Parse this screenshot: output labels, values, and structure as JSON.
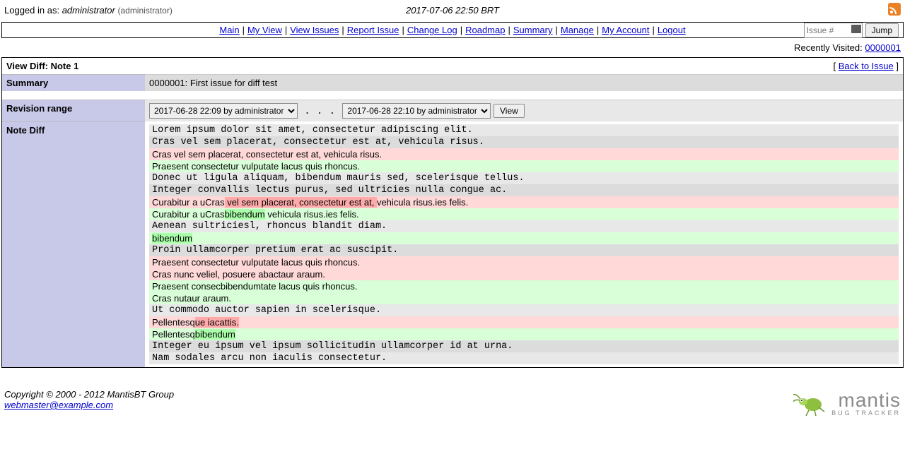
{
  "top": {
    "logged_in_prefix": "Logged in as:",
    "username": "administrator",
    "role": "(administrator)",
    "datetime": "2017-07-06 22:50 BRT"
  },
  "nav": {
    "links": [
      "Main",
      "My View",
      "View Issues",
      "Report Issue",
      "Change Log",
      "Roadmap",
      "Summary",
      "Manage",
      "My Account",
      "Logout"
    ],
    "issue_placeholder": "Issue #",
    "jump_label": "Jump"
  },
  "recently": {
    "label": "Recently Visited:",
    "link": "0000001"
  },
  "panel": {
    "title": "View Diff: Note 1",
    "back_prefix": "[ ",
    "back_link": "Back to Issue",
    "back_suffix": " ]",
    "summary_label": "Summary",
    "summary_value": "0000001: First issue for diff test",
    "revision_label": "Revision range",
    "rev_from": "2017-06-28 22:09 by administrator",
    "rev_to": "2017-06-28 22:10 by administrator",
    "dots": ". . .",
    "view_label": "View",
    "diff_label": "Note Diff"
  },
  "diff": {
    "lines": [
      {
        "class": "mono ctx-a",
        "text": "Lorem ipsum dolor sit amet, consectetur adipiscing elit."
      },
      {
        "class": "mono ctx-b",
        "text": "Cras vel sem placerat, consectetur est at, vehicula risus."
      },
      {
        "class": "del-line",
        "segments": [
          {
            "t": "Cras vel sem placerat, consectetur est at, vehicula risus."
          }
        ]
      },
      {
        "class": "add-line",
        "segments": [
          {
            "t": "Praesent consectetur vulputate lacus quis rhoncus."
          }
        ]
      },
      {
        "class": "mono ctx-a",
        "text": "Donec ut ligula aliquam, bibendum mauris sed, scelerisque tellus."
      },
      {
        "class": "mono ctx-b",
        "text": "Integer convallis lectus purus, sed ultricies nulla congue ac."
      },
      {
        "class": "del-line",
        "segments": [
          {
            "t": "Curabitur a uCras"
          },
          {
            "t": " vel sem placerat, consectetur est at, ",
            "c": "inline-del"
          },
          {
            "t": "vehicula risus.ies felis."
          }
        ]
      },
      {
        "class": "add-line",
        "segments": [
          {
            "t": "Curabitur a uCras"
          },
          {
            "t": "bibendum",
            "c": "inline-add"
          },
          {
            "t": " vehicula risus.ies felis."
          }
        ]
      },
      {
        "class": "mono ctx-a",
        "text": "Aenean sultriciesl, rhoncus blandit diam."
      },
      {
        "class": "add-line",
        "segments": [
          {
            "t": "bibendum",
            "c": "inline-add"
          }
        ]
      },
      {
        "class": "mono ctx-b",
        "text": "Proin ullamcorper pretium erat ac suscipit."
      },
      {
        "class": "del-line",
        "segments": [
          {
            "t": "Praesent consectetur vulputate lacus quis rhoncus."
          }
        ]
      },
      {
        "class": "del-line",
        "segments": [
          {
            "t": "Cras nunc veliel, posuere abactaur araum."
          }
        ]
      },
      {
        "class": "add-line",
        "segments": [
          {
            "t": "Praesent consecbibendumtate lacus quis rhoncus."
          }
        ]
      },
      {
        "class": "add-line",
        "segments": [
          {
            "t": "Cras nutaur araum."
          }
        ]
      },
      {
        "class": "mono ctx-a",
        "text": "Ut commodo auctor sapien in scelerisque."
      },
      {
        "class": "del-line",
        "segments": [
          {
            "t": "Pellentesq"
          },
          {
            "t": "ue iacattis.",
            "c": "inline-del"
          }
        ]
      },
      {
        "class": "add-line",
        "segments": [
          {
            "t": "Pellentesq"
          },
          {
            "t": "bibendum",
            "c": "inline-add"
          }
        ]
      },
      {
        "class": "mono ctx-b",
        "text": "Integer eu ipsum vel ipsum sollicitudin ullamcorper id at urna."
      },
      {
        "class": "mono ctx-a",
        "text": "Nam sodales arcu non iaculis consectetur."
      }
    ]
  },
  "footer": {
    "copyright": "Copyright © 2000 - 2012 MantisBT Group",
    "email": "webmaster@example.com",
    "logo_big": "mantis",
    "logo_small": "BUG TRACKER"
  }
}
